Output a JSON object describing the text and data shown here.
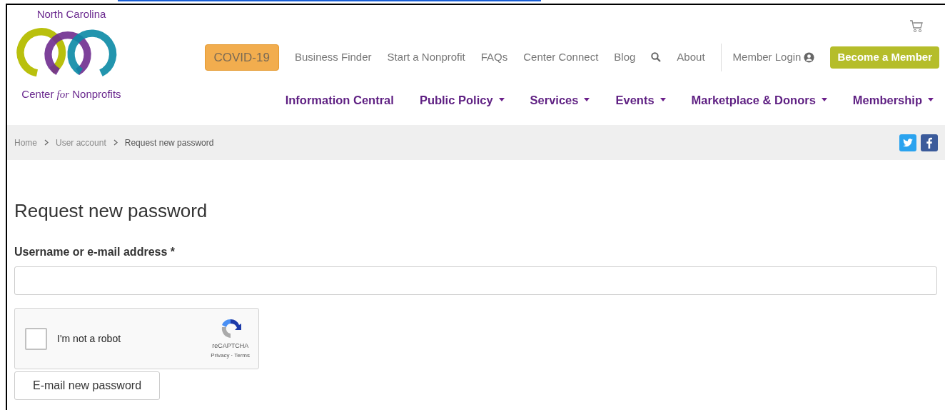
{
  "logo": {
    "top_text": "North Carolina",
    "bottom_before": "Center ",
    "bottom_italic": "for",
    "bottom_after": " Nonprofits"
  },
  "utility_nav": [
    {
      "label": "COVID-19",
      "kind": "highlight"
    },
    {
      "label": "Business Finder",
      "kind": "link"
    },
    {
      "label": "Start a Nonprofit",
      "kind": "link"
    },
    {
      "label": "FAQs",
      "kind": "link"
    },
    {
      "label": "Center Connect",
      "kind": "link"
    },
    {
      "label": "Blog",
      "kind": "link"
    },
    {
      "kind": "search"
    },
    {
      "label": "About",
      "kind": "link"
    },
    {
      "label": "Member Login",
      "kind": "login"
    },
    {
      "label": "Become a Member",
      "kind": "cta"
    }
  ],
  "main_nav": [
    {
      "label": "Information Central",
      "dropdown": false
    },
    {
      "label": "Public Policy",
      "dropdown": true
    },
    {
      "label": "Services",
      "dropdown": true
    },
    {
      "label": "Events",
      "dropdown": true
    },
    {
      "label": "Marketplace & Donors",
      "dropdown": true
    },
    {
      "label": "Membership",
      "dropdown": true
    }
  ],
  "breadcrumb": [
    "Home",
    "User account",
    "Request new password"
  ],
  "page_title": "Request new password",
  "form": {
    "label": "Username or e-mail address",
    "required_mark": "*",
    "captcha": {
      "label": "I'm not a robot",
      "checked": false,
      "brand": "reCAPTCHA",
      "privacy": "Privacy",
      "separator": "·",
      "terms": "Terms"
    },
    "submit": "E-mail new password"
  }
}
